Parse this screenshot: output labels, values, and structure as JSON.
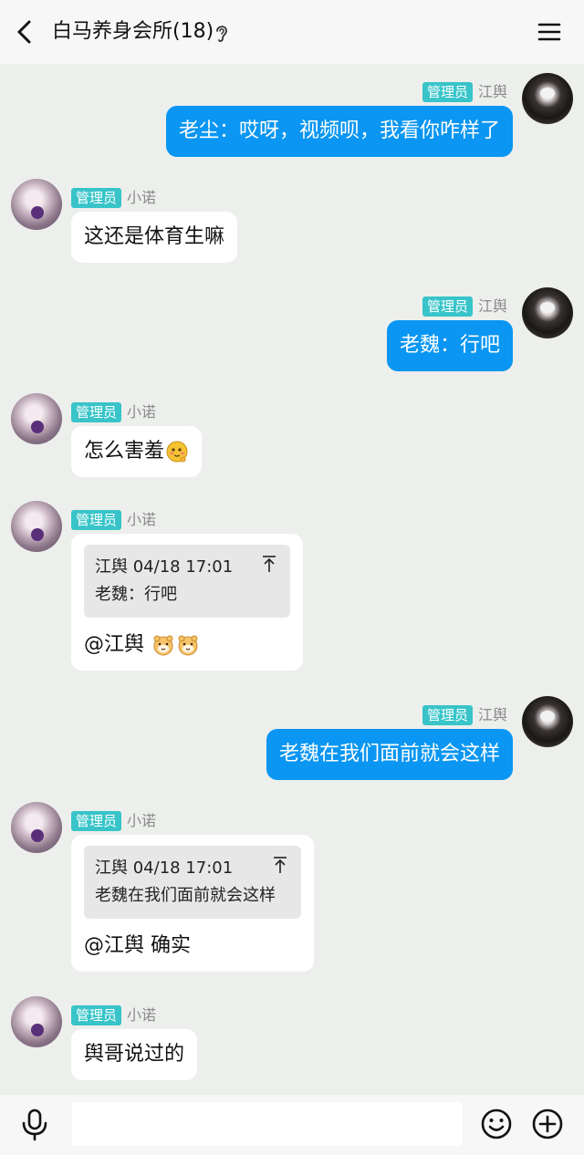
{
  "header": {
    "title": "白马养身会所(18)",
    "back_icon": "chevron-left-icon",
    "ear_icon": "ear-icon",
    "menu_icon": "hamburger-menu-icon"
  },
  "messages": [
    {
      "side": "right",
      "badge": "管理员",
      "nick": "江舆",
      "text": "老尘：哎呀，视频呗，我看你咋样了"
    },
    {
      "side": "left",
      "badge": "管理员",
      "nick": "小诺",
      "text": "这还是体育生嘛"
    },
    {
      "side": "right",
      "badge": "管理员",
      "nick": "江舆",
      "text": "老魏：行吧"
    },
    {
      "side": "left",
      "badge": "管理员",
      "nick": "小诺",
      "text": "怎么害羞",
      "emoji": "shy-face-emoji"
    },
    {
      "side": "left",
      "badge": "管理员",
      "nick": "小诺",
      "quote": {
        "header": "江舆 04/18 17:01",
        "body": "老魏：行吧"
      },
      "text": "@江舆 ",
      "emoji": "hamster-face-emoji x2"
    },
    {
      "side": "right",
      "badge": "管理员",
      "nick": "江舆",
      "text": "老魏在我们面前就会这样"
    },
    {
      "side": "left",
      "badge": "管理员",
      "nick": "小诺",
      "quote": {
        "header": "江舆 04/18 17:01",
        "body": "老魏在我们面前就会这样"
      },
      "text": "@江舆 确实"
    },
    {
      "side": "left",
      "badge": "管理员",
      "nick": "小诺",
      "text": "舆哥说过的"
    }
  ],
  "input": {
    "placeholder": "",
    "mic_icon": "microphone-icon",
    "emoji_icon": "smiley-icon",
    "plus_icon": "plus-circle-icon"
  },
  "colors": {
    "background": "#ecefec",
    "outgoing_bubble": "#0a96f2",
    "incoming_bubble": "#ffffff",
    "admin_badge": "#38c4c9"
  }
}
